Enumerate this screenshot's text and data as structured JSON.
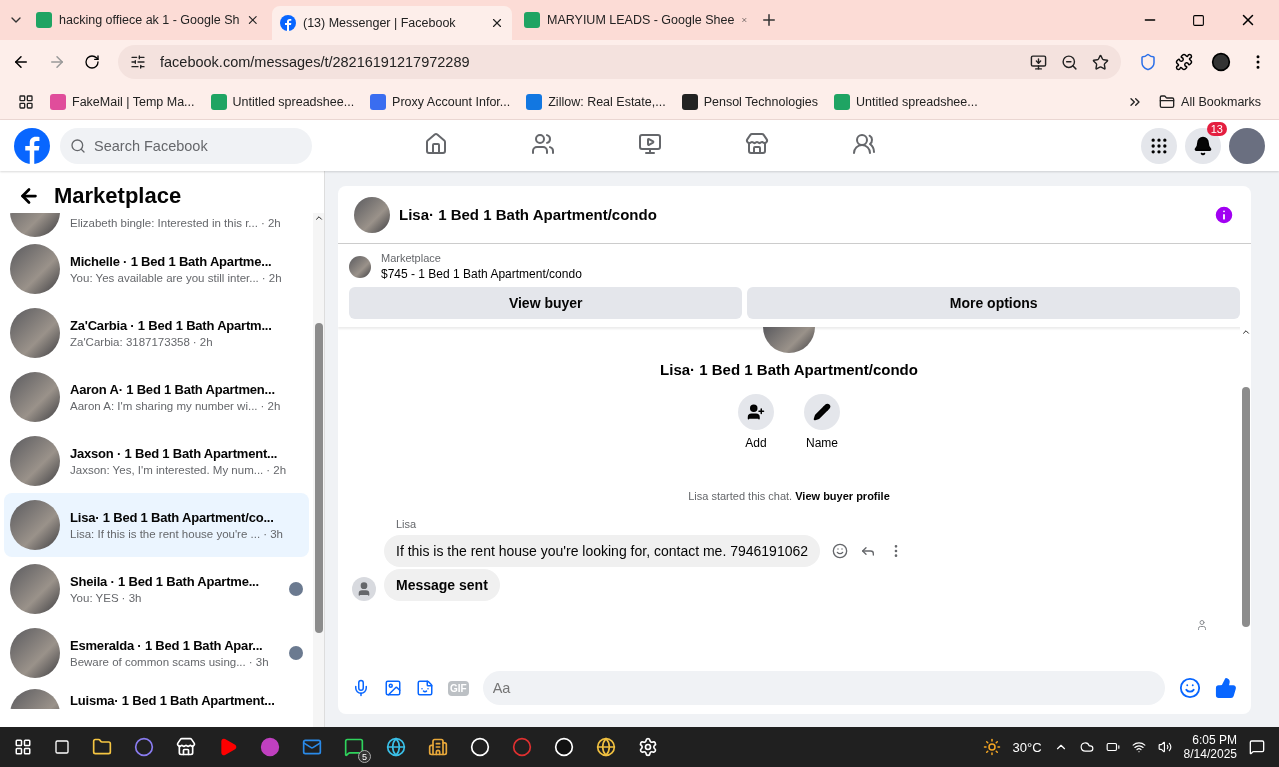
{
  "browser": {
    "tabs": [
      {
        "title": "hacking offiece ak 1 - Google Sh",
        "kind": "sheet",
        "selected": false
      },
      {
        "title": "(13) Messenger | Facebook",
        "kind": "facebook",
        "selected": true
      },
      {
        "title": "MARYIUM LEADS - Google Shee",
        "kind": "sheet",
        "selected": false
      }
    ],
    "url": "facebook.com/messages/t/28216191217972289",
    "bookmarks": [
      "FakeMail | Temp Ma...",
      "Untitled spreadshee...",
      "Proxy Account Infor...",
      "Zillow: Real Estate,...",
      "Pensol Technologies",
      "Untitled spreadshee..."
    ],
    "all_bookmarks": "All Bookmarks"
  },
  "facebook": {
    "search": {
      "placeholder": "Search Facebook"
    },
    "nav": [
      {
        "selected": false
      },
      {
        "selected": false
      },
      {
        "selected": false
      },
      {
        "selected": false
      },
      {
        "selected": false
      }
    ],
    "notifications_count": "13"
  },
  "sidebar": {
    "title": "Marketplace",
    "items": [
      {
        "preview": "Elizabeth bingle: Interested in this r...",
        "time": "· 2h",
        "selected": false,
        "read_receipt": false
      },
      {
        "name": "Michelle · 1 Bed 1 Bath Apartme...",
        "preview": "You: Yes available are you still inter...",
        "time": "· 2h",
        "selected": false,
        "read_receipt": false
      },
      {
        "name": "Za'Carbia · 1 Bed 1 Bath Apartm...",
        "preview": "Za'Carbia: 3187173358",
        "time": "· 2h",
        "selected": false,
        "read_receipt": false
      },
      {
        "name": "Aaron A· 1 Bed 1 Bath Apartmen...",
        "preview": "Aaron A: I'm sharing my number wi...",
        "time": "· 2h",
        "selected": false,
        "read_receipt": false
      },
      {
        "name": "Jaxson · 1 Bed 1 Bath Apartment...",
        "preview": "Jaxson: Yes, I'm interested. My num...",
        "time": "· 2h",
        "selected": false,
        "read_receipt": false
      },
      {
        "name": "Lisa· 1 Bed 1 Bath Apartment/co...",
        "preview": "Lisa: If this is the rent house you're ...",
        "time": "· 3h",
        "selected": true,
        "read_receipt": false
      },
      {
        "name": "Sheila · 1 Bed 1 Bath Apartme...",
        "preview": "You: YES",
        "time": "· 3h",
        "selected": false,
        "read_receipt": true
      },
      {
        "name": "Esmeralda · 1 Bed 1 Bath Apar...",
        "preview": "Beware of common scams using...",
        "time": "· 3h",
        "selected": false,
        "read_receipt": true
      },
      {
        "name": "Luisma· 1 Bed 1 Bath Apartment...",
        "selected": false
      }
    ]
  },
  "chat": {
    "title": "Lisa· 1 Bed 1 Bath Apartment/condo",
    "listing": {
      "label": "Marketplace",
      "title": "$745 - 1 Bed 1 Bath Apartment/condo"
    },
    "buttons": [
      "View buyer",
      "More options"
    ],
    "profile": {
      "name": "Lisa· 1 Bed 1 Bath Apartment/condo",
      "actions": [
        "Add",
        "Name"
      ]
    },
    "system_note": {
      "text": "Lisa started this chat.",
      "link": "View buyer profile"
    },
    "sender": "Lisa",
    "messages": [
      {
        "text": "If this is the rent house you're looking for, contact me. 7946191062",
        "bold": false
      },
      {
        "text": "Message sent",
        "bold": true
      }
    ],
    "composer": {
      "placeholder": "Aa",
      "gif": "GIF"
    }
  },
  "taskbar": {
    "whatsapp_badge": "5",
    "weather": "30°C",
    "time": "6:05 PM",
    "date": "8/14/2025"
  }
}
